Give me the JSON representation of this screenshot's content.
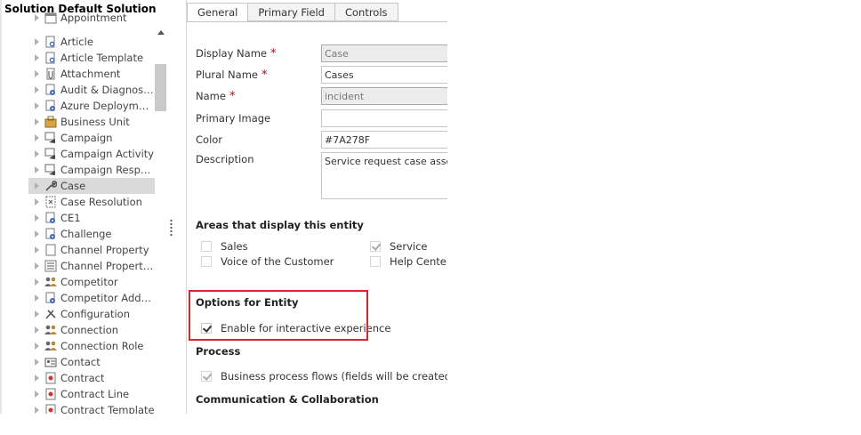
{
  "tree": {
    "title": "Solution Default Solution",
    "items": [
      {
        "label": "Appointment",
        "icon": "calendar-icon"
      },
      {
        "label": "Article",
        "icon": "article-icon"
      },
      {
        "label": "Article Template",
        "icon": "article-template-icon"
      },
      {
        "label": "Attachment",
        "icon": "attachment-icon"
      },
      {
        "label": "Audit & Diagnostic...",
        "icon": "settings-gear-icon"
      },
      {
        "label": "Azure Deployment",
        "icon": "cog-document-icon"
      },
      {
        "label": "Business Unit",
        "icon": "business-unit-icon"
      },
      {
        "label": "Campaign",
        "icon": "campaign-icon"
      },
      {
        "label": "Campaign Activity",
        "icon": "campaign-activity-icon"
      },
      {
        "label": "Campaign Response",
        "icon": "campaign-response-icon"
      },
      {
        "label": "Case",
        "icon": "wrench-icon"
      },
      {
        "label": "Case Resolution",
        "icon": "case-resolution-icon"
      },
      {
        "label": "CE1",
        "icon": "cog-document-icon"
      },
      {
        "label": "Challenge",
        "icon": "cog-document-icon"
      },
      {
        "label": "Channel Property",
        "icon": "document-icon"
      },
      {
        "label": "Channel Property G...",
        "icon": "property-group-icon"
      },
      {
        "label": "Competitor",
        "icon": "users-icon"
      },
      {
        "label": "Competitor Address",
        "icon": "cog-document-icon"
      },
      {
        "label": "Configuration",
        "icon": "tools-icon"
      },
      {
        "label": "Connection",
        "icon": "connection-icon"
      },
      {
        "label": "Connection Role",
        "icon": "connection-role-icon"
      },
      {
        "label": "Contact",
        "icon": "contact-card-icon"
      },
      {
        "label": "Contract",
        "icon": "contract-icon"
      },
      {
        "label": "Contract Line",
        "icon": "contract-line-icon"
      },
      {
        "label": "Contract Template",
        "icon": "contract-template-icon"
      }
    ],
    "selected": "Case"
  },
  "tabs": [
    "General",
    "Primary Field",
    "Controls"
  ],
  "active_tab": "General",
  "fields": {
    "display_name": {
      "label": "Display Name",
      "value": "Case",
      "required": "*"
    },
    "plural_name": {
      "label": "Plural Name",
      "value": "Cases",
      "required": "*"
    },
    "name": {
      "label": "Name",
      "value": "incident",
      "required": "*"
    },
    "primary_image": {
      "label": "Primary Image",
      "value": ""
    },
    "color": {
      "label": "Color",
      "value": "#7A278F"
    },
    "description": {
      "label": "Description",
      "value": "Service request case associat"
    }
  },
  "areas": {
    "title": "Areas that display this entity",
    "options": [
      {
        "label": "Sales",
        "checked": false
      },
      {
        "label": "Service",
        "checked": true
      },
      {
        "label": "Voice of the Customer",
        "checked": false
      },
      {
        "label": "Help Center",
        "checked": false
      }
    ]
  },
  "options_for_entity": {
    "title": "Options for Entity",
    "interactive_label": "Enable for interactive experience",
    "interactive_checked": true
  },
  "process": {
    "title": "Process",
    "bpf_label": "Business process flows (fields will be created) †",
    "bpf_checked": true
  },
  "communication": {
    "title": "Communication & Collaboration"
  },
  "colors": {
    "highlight": "#d62828",
    "required": "#cc0000",
    "selected_row": "#dadada"
  }
}
